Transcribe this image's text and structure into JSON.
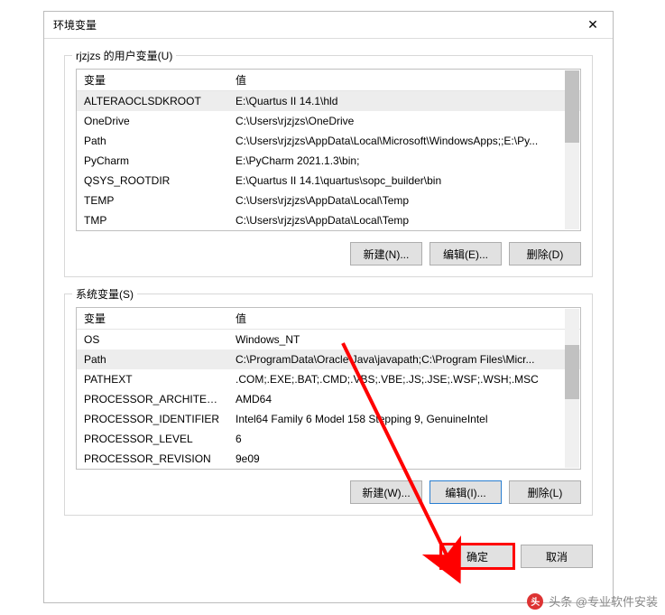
{
  "dialog": {
    "title": "环境变量",
    "close": "✕"
  },
  "user_group": {
    "label": "rjzjzs 的用户变量(U)",
    "col_name": "变量",
    "col_value": "值",
    "rows": [
      {
        "name": "ALTERAOCLSDKROOT",
        "value": "E:\\Quartus II 14.1\\hld"
      },
      {
        "name": "OneDrive",
        "value": "C:\\Users\\rjzjzs\\OneDrive"
      },
      {
        "name": "Path",
        "value": "C:\\Users\\rjzjzs\\AppData\\Local\\Microsoft\\WindowsApps;;E:\\Py..."
      },
      {
        "name": "PyCharm",
        "value": "E:\\PyCharm 2021.1.3\\bin;"
      },
      {
        "name": "QSYS_ROOTDIR",
        "value": "E:\\Quartus II 14.1\\quartus\\sopc_builder\\bin"
      },
      {
        "name": "TEMP",
        "value": "C:\\Users\\rjzjzs\\AppData\\Local\\Temp"
      },
      {
        "name": "TMP",
        "value": "C:\\Users\\rjzjzs\\AppData\\Local\\Temp"
      }
    ],
    "btn_new": "新建(N)...",
    "btn_edit": "编辑(E)...",
    "btn_del": "删除(D)"
  },
  "system_group": {
    "label": "系统变量(S)",
    "col_name": "变量",
    "col_value": "值",
    "rows": [
      {
        "name": "OS",
        "value": "Windows_NT"
      },
      {
        "name": "Path",
        "value": "C:\\ProgramData\\Oracle\\Java\\javapath;C:\\Program Files\\Micr..."
      },
      {
        "name": "PATHEXT",
        "value": ".COM;.EXE;.BAT;.CMD;.VBS;.VBE;.JS;.JSE;.WSF;.WSH;.MSC"
      },
      {
        "name": "PROCESSOR_ARCHITECT...",
        "value": "AMD64"
      },
      {
        "name": "PROCESSOR_IDENTIFIER",
        "value": "Intel64 Family 6 Model 158 Stepping 9, GenuineIntel"
      },
      {
        "name": "PROCESSOR_LEVEL",
        "value": "6"
      },
      {
        "name": "PROCESSOR_REVISION",
        "value": "9e09"
      }
    ],
    "btn_new": "新建(W)...",
    "btn_edit": "编辑(I)...",
    "btn_del": "删除(L)"
  },
  "dialog_buttons": {
    "ok": "确定",
    "cancel": "取消"
  },
  "watermark": {
    "logo": "头",
    "text": "头条 @专业软件安装"
  }
}
